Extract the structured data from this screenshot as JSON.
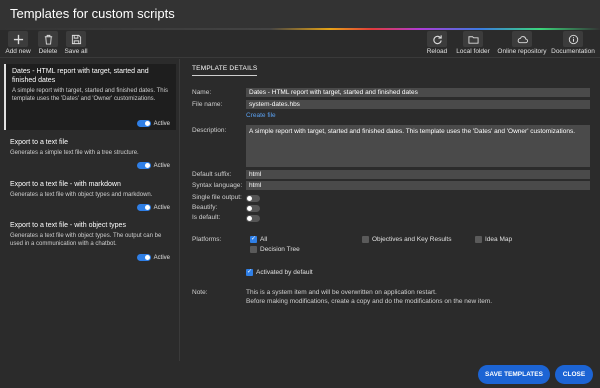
{
  "window": {
    "title": "Templates for custom scripts"
  },
  "toolbar": {
    "add_new": "Add new",
    "delete": "Delete",
    "save_all": "Save all",
    "reload": "Reload",
    "local_folder": "Local folder",
    "online_repository": "Online repository",
    "documentation": "Documentation"
  },
  "templates": [
    {
      "title": "Dates - HTML report with target, started and finished dates",
      "description": "A simple report with target, started and finished dates. This template uses the 'Dates' and 'Owner' customizations.",
      "active_label": "Active",
      "active": true
    },
    {
      "title": "Export to a text file",
      "description": "Generates a simple text file with a tree structure.",
      "active_label": "Active",
      "active": true
    },
    {
      "title": "Export to a text file - with markdown",
      "description": "Generates a text file with object types and markdown.",
      "active_label": "Active",
      "active": true
    },
    {
      "title": "Export to a text file - with object types",
      "description": "Generates a text file with object types. The output can be used in a communication with a chatbot.",
      "active_label": "Active",
      "active": true
    }
  ],
  "details": {
    "tab_title": "TEMPLATE DETAILS",
    "name_label": "Name:",
    "name_value": "Dates - HTML report with target, started and finished dates",
    "file_name_label": "File name:",
    "file_name_value": "system-dates.hbs",
    "create_file": "Create file",
    "description_label": "Description:",
    "description_value": "A simple report with target, started and finished dates. This template uses the 'Dates' and 'Owner' customizations.",
    "default_suffix_label": "Default suffix:",
    "default_suffix_value": "html",
    "syntax_language_label": "Syntax language:",
    "syntax_language_value": "html",
    "single_file_output_label": "Single file output:",
    "single_file_output": false,
    "beautify_label": "Beautify:",
    "beautify": false,
    "is_default_label": "Is default:",
    "is_default": false,
    "platforms_label": "Platforms:",
    "platforms": [
      {
        "label": "All",
        "checked": true
      },
      {
        "label": "Objectives and Key Results",
        "checked": false
      },
      {
        "label": "Idea Map",
        "checked": false
      },
      {
        "label": "Decision Tree",
        "checked": false
      }
    ],
    "activated_by_default_label": "Activated by default",
    "activated_by_default": true,
    "note_label": "Note:",
    "note_line1": "This is a system item and will be overwritten on application restart.",
    "note_line2": "Before making modifications, create a copy and do the modifications on the new item."
  },
  "footer": {
    "save_templates": "SAVE TEMPLATES",
    "close": "CLOSE"
  },
  "colors": {
    "accent": "#1c64d4",
    "toggle_on": "#2f7fe6",
    "link": "#5aa0f0"
  }
}
